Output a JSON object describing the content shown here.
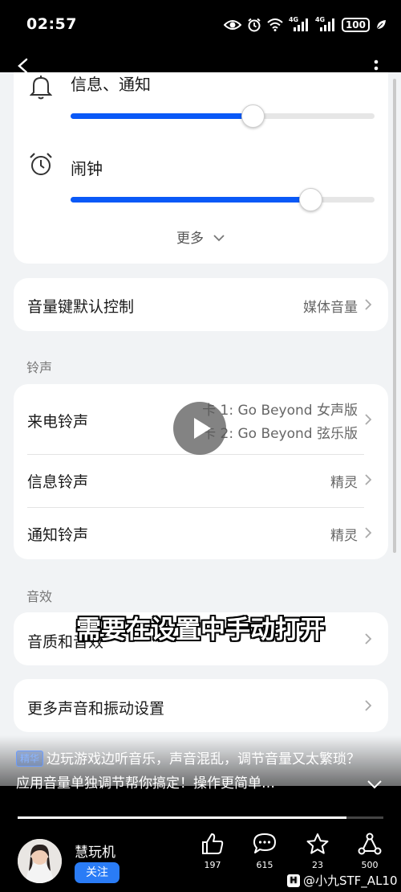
{
  "status_bar": {
    "time": "02:57",
    "signal_1": "4G",
    "signal_2": "4G",
    "battery": "100"
  },
  "volume_card": {
    "sliders": [
      {
        "label": "信息、通知",
        "icon": "bell-icon",
        "level": 0.6
      },
      {
        "label": "闹钟",
        "icon": "alarm-clock-icon",
        "level": 0.79
      }
    ],
    "more_label": "更多"
  },
  "volume_key": {
    "label": "音量键默认控制",
    "value": "媒体音量"
  },
  "ringtone_section": {
    "header": "铃声",
    "incoming": {
      "label": "来电铃声",
      "sim1": "卡 1: Go Beyond 女声版",
      "sim2": "卡 2: Go Beyond 弦乐版"
    },
    "message": {
      "label": "信息铃声",
      "value": "精灵"
    },
    "notification": {
      "label": "通知铃声",
      "value": "精灵"
    }
  },
  "effects_section": {
    "header": "音效",
    "quality_label": "音质和音效"
  },
  "more_settings": {
    "label": "更多声音和振动设置"
  },
  "video": {
    "caption": "需要在设置中手动打开",
    "badge": "精华",
    "description": "边玩游戏边听音乐，声音混乱，调节音量又太繁琐？应用音量单独调节帮你搞定！操作更简单…",
    "progress": 0.9
  },
  "author": {
    "name": "慧玩机",
    "follow_label": "关注"
  },
  "actions": {
    "likes": "197",
    "comments": "615",
    "favorites": "23",
    "shares": "500"
  },
  "watermark": {
    "logo": "H",
    "text": "@小九STF_AL10"
  },
  "colors": {
    "accent": "#0a59f7",
    "follow": "#2a7cf6"
  }
}
